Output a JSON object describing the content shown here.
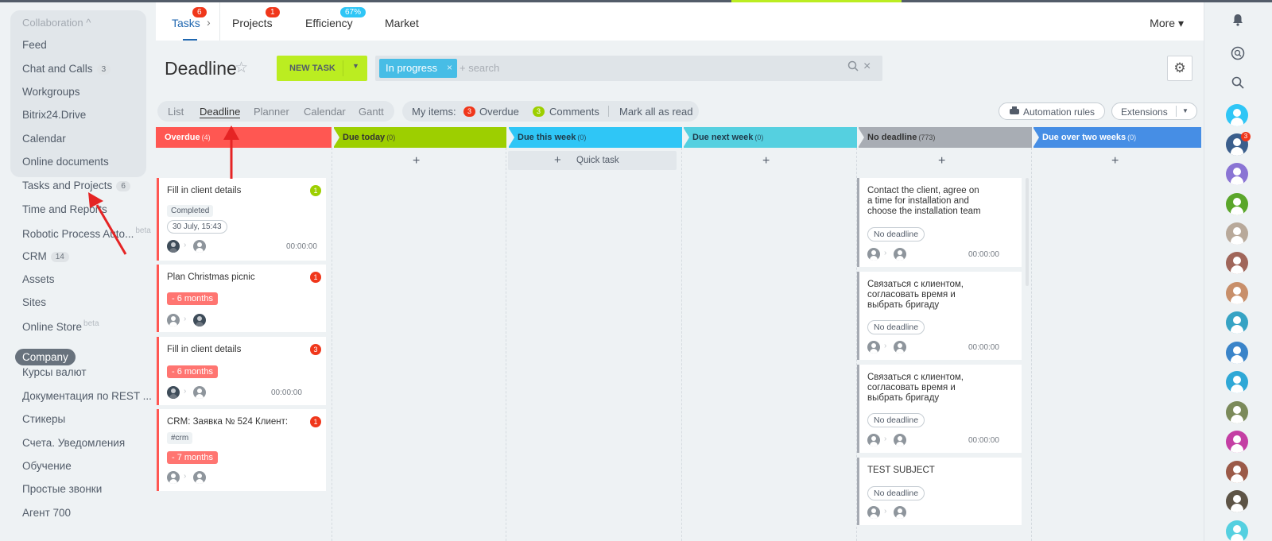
{
  "left_menu": {
    "group_title": "Collaboration ^",
    "items": [
      {
        "label": "Feed",
        "count": ""
      },
      {
        "label": "Chat and Calls",
        "count": "3"
      },
      {
        "label": "Workgroups",
        "count": ""
      },
      {
        "label": "Bitrix24.Drive",
        "count": ""
      },
      {
        "label": "Calendar",
        "count": ""
      },
      {
        "label": "Online documents",
        "count": ""
      },
      {
        "label": "Tasks and Projects",
        "count": "6"
      },
      {
        "label": "Time and Reports",
        "count": ""
      },
      {
        "label": "Robotic Process Auto...",
        "sup": "beta"
      },
      {
        "label": "CRM",
        "count": "14"
      },
      {
        "label": "Assets",
        "count": ""
      },
      {
        "label": "Sites",
        "count": ""
      },
      {
        "label": "Online Store",
        "sup": "beta"
      },
      {
        "label": "Company",
        "count": ""
      },
      {
        "label": "Курсы валют",
        "count": ""
      },
      {
        "label": "Документация по REST ...",
        "count": ""
      },
      {
        "label": "Стикеры",
        "count": ""
      },
      {
        "label": "Счета. Уведомления",
        "count": ""
      },
      {
        "label": "Обучение",
        "count": ""
      },
      {
        "label": "Простые звонки",
        "count": ""
      },
      {
        "label": "Агент 700",
        "count": ""
      }
    ]
  },
  "top_tabs": {
    "tasks": {
      "label": "Tasks",
      "badge": "6"
    },
    "projects": {
      "label": "Projects",
      "badge": "1"
    },
    "efficiency": {
      "label": "Efficiency",
      "badge": "67%"
    },
    "market": {
      "label": "Market"
    },
    "more": "More ▾"
  },
  "header": {
    "title": "Deadline",
    "new_task": "NEW TASK",
    "filter_chip": "In progress",
    "search_placeholder": "+ search"
  },
  "views": {
    "list": "List",
    "deadline": "Deadline",
    "planner": "Planner",
    "calendar": "Calendar",
    "gantt": "Gantt",
    "active": "Deadline"
  },
  "my_items": {
    "label": "My items:",
    "overdue_count": "3",
    "overdue_label": "Overdue",
    "comments_count": "3",
    "comments_label": "Comments",
    "mark_all": "Mark all as read"
  },
  "automation_rules": "Automation rules",
  "extensions": "Extensions",
  "colors": {
    "overdue": "#ff5752",
    "today": "#9dcf00",
    "week": "#2fc6f6",
    "next_week": "#55d0e0",
    "no_deadline": "#a8adb4",
    "over_two": "#468ee5",
    "accent": "#bbed21"
  },
  "columns": [
    {
      "name": "Overdue",
      "count": "(4)"
    },
    {
      "name": "Due today",
      "count": "(0)"
    },
    {
      "name": "Due this week",
      "count": "(0)"
    },
    {
      "name": "Due next week",
      "count": "(0)"
    },
    {
      "name": "No deadline",
      "count": "(773)"
    },
    {
      "name": "Due over two weeks",
      "count": "(0)"
    }
  ],
  "quick_task": "Quick task",
  "overdue_cards": [
    {
      "title": "Fill in client details",
      "counter": "1",
      "status_tag": "Completed",
      "date": "30 July, 15:43",
      "time": "00:00:00"
    },
    {
      "title": "Plan Christmas picnic",
      "counter": "1",
      "overdue": "- 6 months"
    },
    {
      "title": "Fill in client details",
      "counter": "3",
      "overdue": "- 6 months",
      "time": "00:00:00"
    },
    {
      "title": "CRM: Заявка № 524 Клиент:",
      "counter": "1",
      "tag": "#crm",
      "overdue": "- 7 months"
    }
  ],
  "nodeadline_cards": [
    {
      "title_lines": [
        "Contact the client, agree on",
        "a time for installation and",
        "choose the installation team"
      ],
      "tag": "No deadline",
      "time": "00:00:00"
    },
    {
      "title_lines": [
        "Связаться с клиентом,",
        "согласовать время и",
        "выбрать бригаду"
      ],
      "tag": "No deadline",
      "time": "00:00:00"
    },
    {
      "title_lines": [
        "Связаться с клиентом,",
        "согласовать время и",
        "выбрать бригаду"
      ],
      "tag": "No deadline",
      "time": "00:00:00"
    },
    {
      "title_lines": [
        "TEST SUBJECT"
      ],
      "tag": "No deadline",
      "time": ""
    }
  ],
  "right_bar": {
    "chat_badge": "3"
  }
}
